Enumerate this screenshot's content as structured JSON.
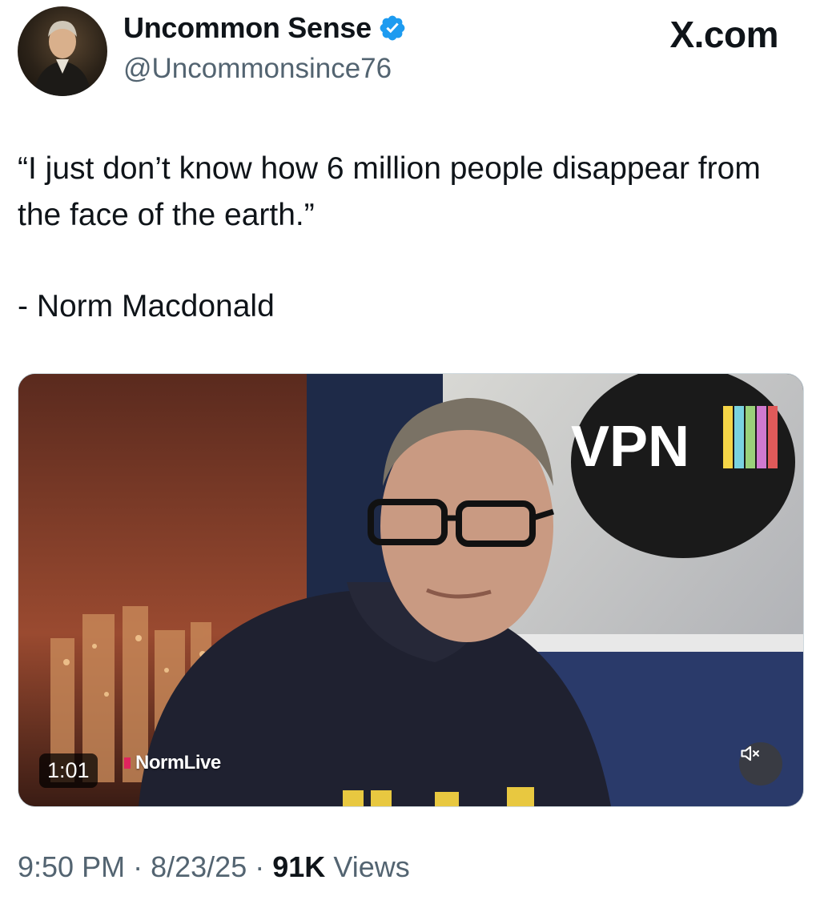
{
  "author": {
    "name": "Uncommon Sense",
    "handle": "@Uncommonsince76"
  },
  "source_label": "X.com",
  "tweet": {
    "quote": "“I just don’t know how 6 million people disappear from the face of the earth.”",
    "attribution": "- Norm Macdonald"
  },
  "video": {
    "duration": "1:01",
    "watermark": "NormLive",
    "logo_text": "VPN",
    "mute_icon": "speaker-muted-icon"
  },
  "meta": {
    "time": "9:50 PM",
    "date": "8/23/25",
    "views_count": "91K",
    "views_label": "Views",
    "separator": "·"
  },
  "colors": {
    "verified": "#1d9bf0",
    "secondary_text": "#536471",
    "primary_text": "#0f1419"
  }
}
